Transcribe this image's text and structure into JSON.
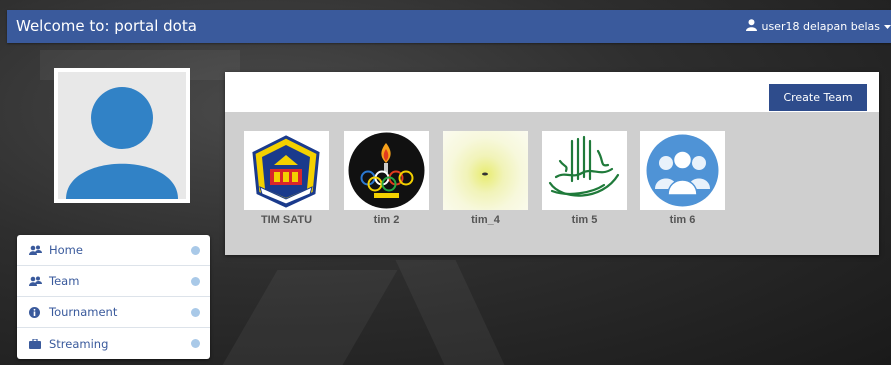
{
  "navbar": {
    "brand": "Welcome to: portal dota",
    "user_label": "user18 delapan belas",
    "user_icon": "user-icon",
    "dropdown_icon": "caret-down-icon",
    "color": "#3a5a9c"
  },
  "profile": {
    "avatar_icon": "user-silhouette-icon"
  },
  "menu": {
    "items": [
      {
        "label": "Home",
        "icon": "users-icon"
      },
      {
        "label": "Team",
        "icon": "users-icon"
      },
      {
        "label": "Tournament",
        "icon": "info-circle-icon"
      },
      {
        "label": "Streaming",
        "icon": "briefcase-icon"
      }
    ]
  },
  "panel": {
    "create_button": "Create Team",
    "teams": [
      {
        "name": "TIM SATU",
        "logo": "university-crest-logo"
      },
      {
        "name": "tim 2",
        "logo": "olga-umk-torch-rings-logo"
      },
      {
        "name": "tim_4",
        "logo": "light-blur-image"
      },
      {
        "name": "tim 5",
        "logo": "arabic-calligraphy-logo"
      },
      {
        "name": "tim 6",
        "logo": "group-users-icon"
      }
    ]
  }
}
